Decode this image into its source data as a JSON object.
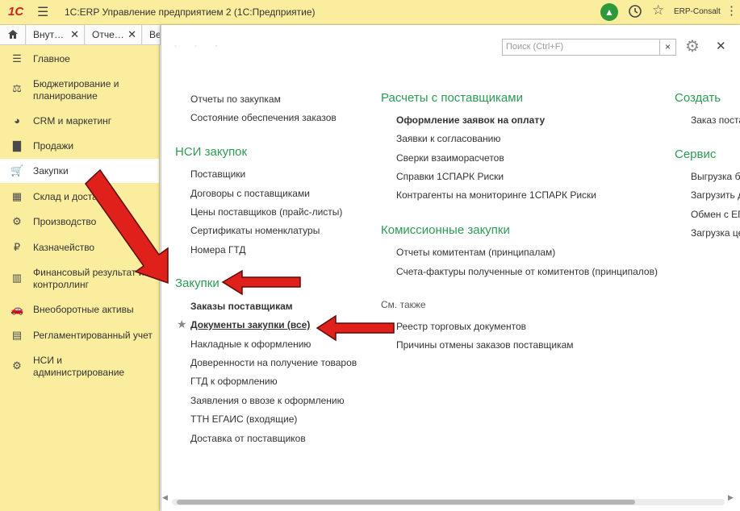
{
  "titlebar": {
    "logo_text": "1С",
    "app_title": "1С:ERP Управление предприятием 2  (1С:Предприятие)",
    "user_name": "ERP-Consalt",
    "icons": [
      "menu-icon",
      "bell-icon",
      "history-icon",
      "star-icon",
      "more-icon"
    ]
  },
  "tabs": [
    {
      "label": "Внут…"
    },
    {
      "label": "Отче…"
    },
    {
      "label": "Ве"
    }
  ],
  "sidebar": {
    "items": [
      {
        "label": "Главное",
        "icon": "menu-icon"
      },
      {
        "label": "Бюджетирование и планирование",
        "icon": "budget-icon"
      },
      {
        "label": "CRM и маркетинг",
        "icon": "pie-chart-icon"
      },
      {
        "label": "Продажи",
        "icon": "bag-icon"
      },
      {
        "label": "Закупки",
        "icon": "cart-icon",
        "active": true
      },
      {
        "label": "Склад и доставка",
        "icon": "warehouse-icon"
      },
      {
        "label": "Производство",
        "icon": "factory-icon"
      },
      {
        "label": "Казначейство",
        "icon": "ruble-coin-icon"
      },
      {
        "label": "Финансовый результат и контроллинг",
        "icon": "bar-chart-icon"
      },
      {
        "label": "Внеоборотные активы",
        "icon": "car-icon"
      },
      {
        "label": "Регламентированный учет",
        "icon": "ledger-icon"
      },
      {
        "label": "НСИ и администрирование",
        "icon": "gear-icon"
      }
    ]
  },
  "main": {
    "search_placeholder": "Поиск (Ctrl+F)",
    "col1": {
      "top_links": [
        "Отчеты по закупкам",
        "Состояние обеспечения заказов"
      ],
      "nsi_heading": "НСИ закупок",
      "nsi_links": [
        "Поставщики",
        "Договоры с поставщиками",
        "Цены поставщиков (прайс-листы)",
        "Сертификаты номенклатуры",
        "Номера ГТД"
      ],
      "purchases_heading": "Закупки",
      "purchases_links": [
        {
          "label": "Заказы поставщикам",
          "style": "bold"
        },
        {
          "label": "Документы закупки (все)",
          "style": "underline"
        },
        {
          "label": "Накладные к оформлению"
        },
        {
          "label": "Доверенности на получение товаров"
        },
        {
          "label": "ГТД к оформлению"
        },
        {
          "label": "Заявления о ввозе к оформлению"
        },
        {
          "label": "ТТН ЕГАИС (входящие)"
        },
        {
          "label": "Доставка от поставщиков"
        }
      ]
    },
    "col2": {
      "settlements_heading": "Расчеты с поставщиками",
      "settlements_links": [
        {
          "label": "Оформление заявок на оплату",
          "style": "bold"
        },
        {
          "label": "Заявки к согласованию"
        },
        {
          "label": "Сверки взаиморасчетов"
        },
        {
          "label": "Справки 1СПАРК Риски"
        },
        {
          "label": "Контрагенты на мониторинге 1СПАРК Риски"
        }
      ],
      "commission_heading": "Комиссионные закупки",
      "commission_links": [
        "Отчеты комитентам (принципалам)",
        "Счета-фактуры полученные от комитентов (принципалов)"
      ],
      "see_also_label": "См. также",
      "see_also_links": [
        "Реестр торговых документов",
        "Причины отмены заказов поставщикам"
      ]
    },
    "col3": {
      "create_heading": "Создать",
      "create_links": [
        "Заказ поста"
      ],
      "service_heading": "Сервис",
      "service_links": [
        "Выгрузка б",
        "Загрузить д",
        "Обмен с ЕГ",
        "Загрузка це"
      ]
    }
  },
  "colors": {
    "panel_bg": "#fbed9e",
    "heading_green": "#2e9a54",
    "arrow_red": "#e0201b",
    "bell_green": "#2c9a3a"
  }
}
